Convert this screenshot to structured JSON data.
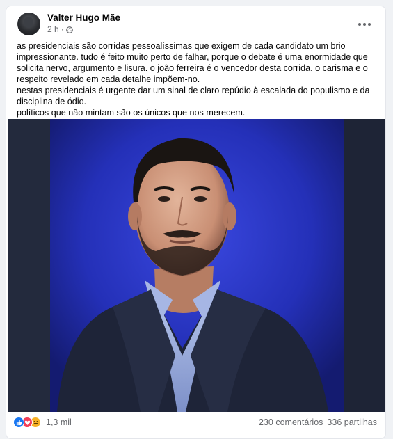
{
  "post": {
    "author": "Valter Hugo Mãe",
    "time": "2 h",
    "separator": "·",
    "text": [
      "as presidenciais são corridas pessoalíssimas que exigem de cada candidato um brio impressionante. tudo é feito muito perto de falhar, porque o debate é uma enormidade que solicita nervo, argumento e lisura. o joão ferreira é o vencedor desta corrida. o carisma e o respeito revelado em cada detalhe impõem-no.",
      "nestas presidenciais é urgente dar um sinal de claro repúdio à escalada do populismo e da disciplina de ódio.",
      "políticos que não mintam são os únicos que nos merecem."
    ]
  },
  "reactions": {
    "icons": [
      "like-icon",
      "love-icon",
      "haha-icon"
    ],
    "count": "1,3 mil",
    "comments": "230 comentários",
    "shares": "336 partilhas"
  },
  "colors": {
    "like": "#1877f2",
    "love": "#f33e58",
    "haha": "#f7b125",
    "photo_bg": "#2430b8"
  }
}
